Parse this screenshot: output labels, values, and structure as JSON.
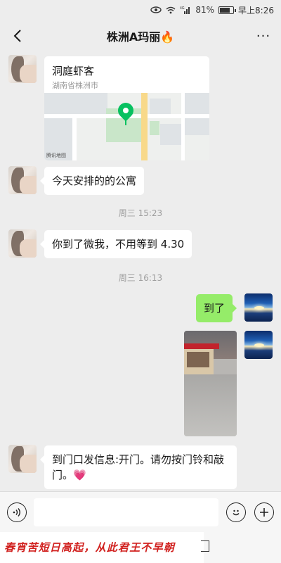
{
  "status_bar": {
    "battery": "81%",
    "battery_level": 0.81,
    "time": "早上8:26",
    "icons": [
      "eye-icon",
      "wifi-icon",
      "signal-4g-icon",
      "battery-icon"
    ]
  },
  "header": {
    "title": "株洲A玛丽🔥",
    "back_icon": "chevron-left-icon",
    "more_label": "···"
  },
  "messages": [
    {
      "type": "location",
      "side": "left",
      "name": "洞庭虾客",
      "address": "湖南省株洲市",
      "map_credit": "腾讯地图"
    },
    {
      "type": "text",
      "side": "left",
      "text": "今天安排的的公寓"
    },
    {
      "type": "time",
      "text": "周三 15:23"
    },
    {
      "type": "text",
      "side": "left",
      "text": "你到了微我，不用等到 4.30"
    },
    {
      "type": "time",
      "text": "周三 16:13"
    },
    {
      "type": "text",
      "side": "right",
      "text": "到了"
    },
    {
      "type": "image",
      "side": "right"
    },
    {
      "type": "text",
      "side": "left",
      "text": "到门口发信息:开门。请勿按门铃和敲门。💗"
    }
  ],
  "input_bar": {
    "voice_icon": "voice-icon",
    "emoji_icon": "emoji-icon",
    "plus_icon": "plus-icon"
  },
  "overlay": {
    "poem": "春宵苦短日高起，从此君王不早朝"
  }
}
